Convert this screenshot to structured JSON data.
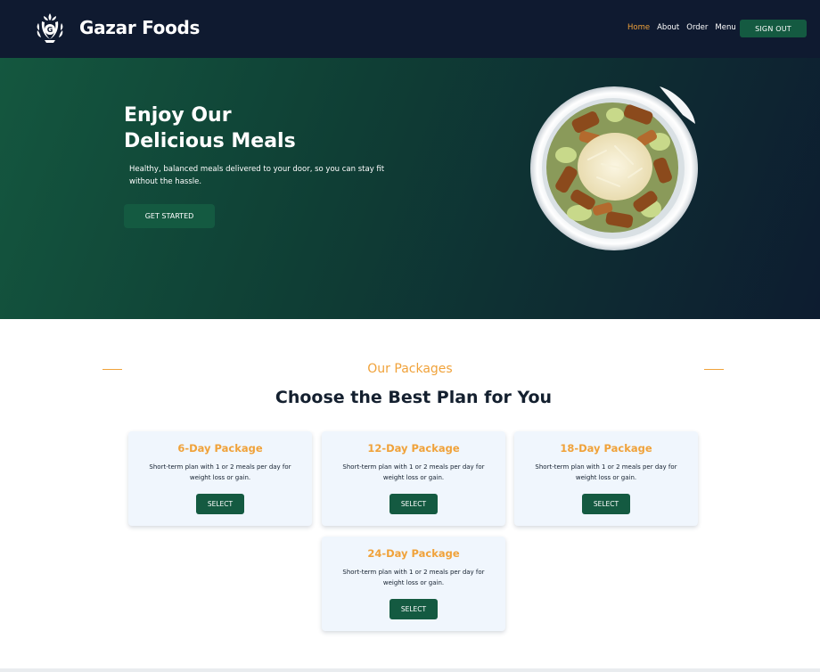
{
  "header": {
    "brand": "Gazar Foods",
    "logo_icon": "leaf-crest-logo",
    "nav": [
      {
        "label": "Home",
        "active": true
      },
      {
        "label": "About",
        "active": false
      },
      {
        "label": "Order",
        "active": false
      },
      {
        "label": "Menu",
        "active": false
      }
    ],
    "signout_label": "SIGN OUT"
  },
  "hero": {
    "title_line1": "Enjoy Our",
    "title_line2": "Delicious Meals",
    "subtitle": "Healthy, balanced meals delivered to your door, so you can stay fit without the hassle.",
    "cta_label": "GET STARTED",
    "image": "chicken-salad-bowl"
  },
  "packages": {
    "kicker": "Our Packages",
    "title": "Choose the Best Plan for You",
    "items": [
      {
        "name": "6-Day Package",
        "description": "Short-term plan with 1 or 2 meals per day for weight loss or gain.",
        "button": "SELECT"
      },
      {
        "name": "12-Day Package",
        "description": "Short-term plan with 1 or 2 meals per day for weight loss or gain.",
        "button": "SELECT"
      },
      {
        "name": "18-Day Package",
        "description": "Short-term plan with 1 or 2 meals per day for weight loss or gain.",
        "button": "SELECT"
      },
      {
        "name": "24-Day Package",
        "description": "Short-term plan with 1 or 2 meals per day for weight loss or gain.",
        "button": "SELECT"
      }
    ]
  },
  "colors": {
    "navy": "#0f1a30",
    "accent_orange": "#f0a23a",
    "brand_green": "#145a41",
    "card_bg": "#f0f6fd"
  }
}
